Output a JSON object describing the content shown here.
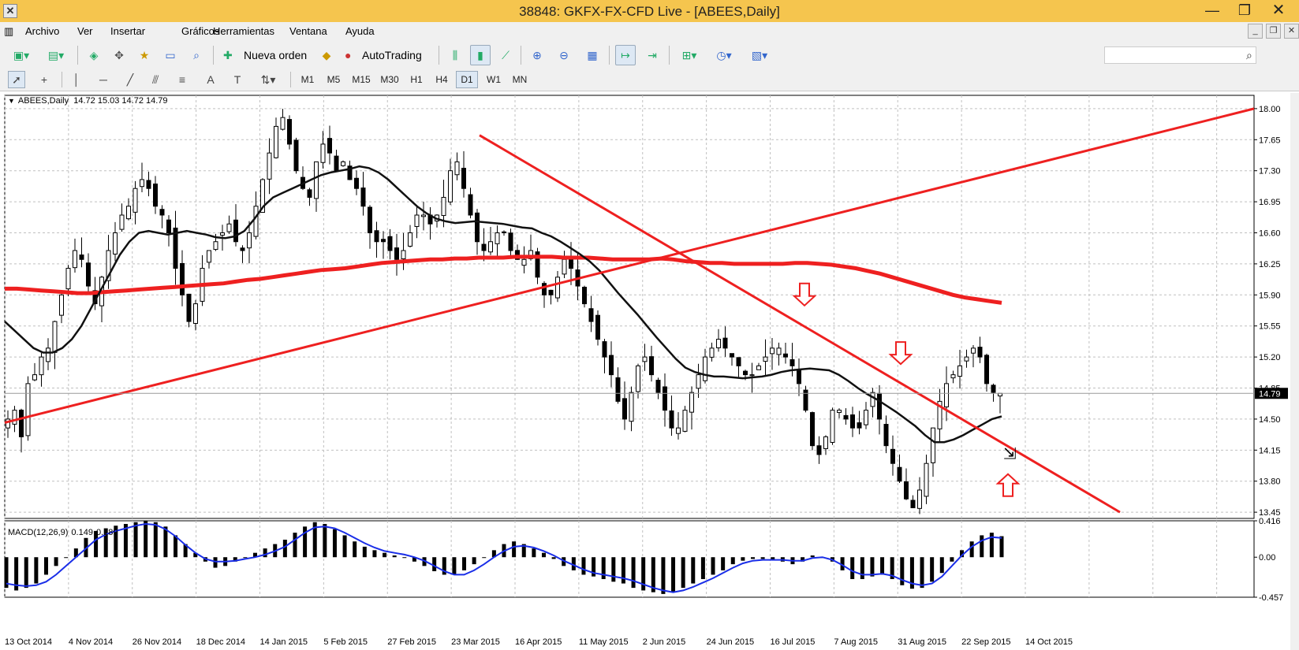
{
  "window": {
    "title": "38848: GKFX-FX-CFD Live - [ABEES,Daily]",
    "minimize": "—",
    "maximize": "❐",
    "close": "✕"
  },
  "menu": {
    "items": [
      "Archivo",
      "Ver",
      "Insertar",
      "Gráficos",
      "Herramientas",
      "Ventana",
      "Ayuda"
    ]
  },
  "toolbar": {
    "new_order": "Nueva orden",
    "autotrading": "AutoTrading",
    "search_placeholder": ""
  },
  "timeframes": [
    "M1",
    "M5",
    "M15",
    "M30",
    "H1",
    "H4",
    "D1",
    "W1",
    "MN"
  ],
  "selected_timeframe": "D1",
  "colors": {
    "trendline": "#ee2020",
    "ma200": "#ee2020",
    "ma50": "#111111",
    "macd_signal": "#1a2ee8",
    "candle": "#000000",
    "grid": "#c0c0c0",
    "titlebar": "#f5c54e"
  },
  "chart_data": {
    "type": "candlestick",
    "symbol_header": {
      "symbol": "ABEES,Daily",
      "ohlc": "14.72 15.03 14.72 14.79"
    },
    "price_axis_ticks": [
      "18.00",
      "17.65",
      "17.30",
      "16.95",
      "16.60",
      "16.25",
      "15.90",
      "15.55",
      "15.20",
      "14.85",
      "14.50",
      "14.15",
      "13.80",
      "13.45"
    ],
    "price_ylim": [
      13.38,
      18.15
    ],
    "current_price": "14.79",
    "date_ticks": [
      "13 Oct 2014",
      "4 Nov 2014",
      "26 Nov 2014",
      "18 Dec 2014",
      "14 Jan 2015",
      "5 Feb 2015",
      "27 Feb 2015",
      "23 Mar 2015",
      "16 Apr 2015",
      "11 May 2015",
      "2 Jun 2015",
      "24 Jun 2015",
      "16 Jul 2015",
      "7 Aug 2015",
      "31 Aug 2015",
      "22 Sep 2015",
      "14 Oct 2015"
    ],
    "closes": [
      14.5,
      14.6,
      14.3,
      14.9,
      15.0,
      15.2,
      15.3,
      15.6,
      15.9,
      16.2,
      16.4,
      16.3,
      16.0,
      15.8,
      16.1,
      16.4,
      16.6,
      16.8,
      16.9,
      17.1,
      17.2,
      17.1,
      16.9,
      16.8,
      16.6,
      16.2,
      15.9,
      15.6,
      15.8,
      16.2,
      16.4,
      16.5,
      16.6,
      16.7,
      16.5,
      16.4,
      16.6,
      16.9,
      17.2,
      17.5,
      17.8,
      17.9,
      17.6,
      17.3,
      17.1,
      17.0,
      17.4,
      17.6,
      17.5,
      17.3,
      17.4,
      17.2,
      17.1,
      16.9,
      16.6,
      16.5,
      16.5,
      16.4,
      16.3,
      16.4,
      16.6,
      16.8,
      16.8,
      16.7,
      16.8,
      17.0,
      17.3,
      17.4,
      17.1,
      16.8,
      16.5,
      16.4,
      16.5,
      16.6,
      16.6,
      16.4,
      16.3,
      16.3,
      16.4,
      16.1,
      15.9,
      15.9,
      16.1,
      16.3,
      16.2,
      16.0,
      15.8,
      15.6,
      15.4,
      15.2,
      15.0,
      14.7,
      14.5,
      14.8,
      15.1,
      15.2,
      15.0,
      14.8,
      14.6,
      14.4,
      14.4,
      14.6,
      14.8,
      15.0,
      15.2,
      15.3,
      15.4,
      15.3,
      15.2,
      15.1,
      15.0,
      15.0,
      15.1,
      15.2,
      15.3,
      15.3,
      15.2,
      15.1,
      14.9,
      14.6,
      14.2,
      14.1,
      14.3,
      14.6,
      14.6,
      14.5,
      14.4,
      14.4,
      14.6,
      14.8,
      14.5,
      14.2,
      14.0,
      13.8,
      13.6,
      13.5,
      13.7,
      14.0,
      14.4,
      14.7,
      14.9,
      15.0,
      15.1,
      15.2,
      15.3,
      15.2,
      14.9,
      14.8,
      14.79
    ],
    "indicators": {
      "ma200_label": "",
      "ma200": [
        15.97,
        15.97,
        15.96,
        15.95,
        15.94,
        15.93,
        15.92,
        15.92,
        15.93,
        15.94,
        15.95,
        15.96,
        15.97,
        15.98,
        15.99,
        16.0,
        16.01,
        16.02,
        16.03,
        16.05,
        16.07,
        16.08,
        16.1,
        16.12,
        16.14,
        16.16,
        16.18,
        16.19,
        16.2,
        16.22,
        16.24,
        16.26,
        16.27,
        16.28,
        16.29,
        16.3,
        16.3,
        16.31,
        16.31,
        16.32,
        16.32,
        16.32,
        16.33,
        16.33,
        16.33,
        16.33,
        16.32,
        16.32,
        16.32,
        16.31,
        16.3,
        16.3,
        16.3,
        16.3,
        16.31,
        16.3,
        16.28,
        16.27,
        16.26,
        16.26,
        16.25,
        16.25,
        16.25,
        16.25,
        16.25,
        16.26,
        16.26,
        16.25,
        16.24,
        16.22,
        16.2,
        16.17,
        16.14,
        16.1,
        16.06,
        16.02,
        15.98,
        15.94,
        15.9,
        15.87,
        15.85,
        15.83,
        15.81
      ],
      "ma50": [
        15.6,
        15.5,
        15.4,
        15.3,
        15.25,
        15.25,
        15.3,
        15.4,
        15.55,
        15.75,
        15.95,
        16.15,
        16.35,
        16.5,
        16.6,
        16.62,
        16.6,
        16.58,
        16.6,
        16.62,
        16.6,
        16.58,
        16.55,
        16.54,
        16.56,
        16.62,
        16.75,
        16.9,
        17.0,
        17.05,
        17.1,
        17.15,
        17.2,
        17.25,
        17.28,
        17.3,
        17.32,
        17.35,
        17.33,
        17.28,
        17.2,
        17.1,
        17.0,
        16.9,
        16.82,
        16.76,
        16.73,
        16.71,
        16.72,
        16.73,
        16.72,
        16.71,
        16.7,
        16.68,
        16.66,
        16.65,
        16.6,
        16.56,
        16.5,
        16.43,
        16.36,
        16.28,
        16.18,
        16.05,
        15.92,
        15.8,
        15.68,
        15.55,
        15.42,
        15.3,
        15.18,
        15.08,
        15.03,
        15.0,
        14.98,
        14.98,
        14.97,
        14.96,
        14.97,
        14.98,
        15.0,
        15.03,
        15.05,
        15.06,
        15.07,
        15.06,
        15.05,
        15.0,
        14.93,
        14.85,
        14.78,
        14.72,
        14.65,
        14.58,
        14.5,
        14.42,
        14.32,
        14.24,
        14.24,
        14.27,
        14.32,
        14.38,
        14.44,
        14.5,
        14.53
      ],
      "trendlines": [
        {
          "from": [
            "13 Oct 2014",
            14.46
          ],
          "to": [
            "off-chart",
            18.0
          ]
        },
        {
          "from": [
            "2 Apr 2015",
            17.7
          ],
          "to": [
            "Nov 2015",
            13.45
          ]
        }
      ],
      "arrows": [
        {
          "date": "10 Aug 2015",
          "direction": "down",
          "price": 15.78
        },
        {
          "date": "3 Sep 2015",
          "direction": "down",
          "price": 15.12
        },
        {
          "date": "18 Oct 2015",
          "direction": "up",
          "price": 13.88
        }
      ]
    },
    "macd": {
      "label": "MACD(12,26,9)",
      "main": "0.149",
      "signal": "0.189",
      "axis_ticks": [
        "0.416",
        "0.00",
        "-0.457"
      ],
      "ylim": [
        -0.457,
        0.416
      ],
      "histogram": [
        -0.35,
        -0.38,
        -0.35,
        -0.3,
        -0.2,
        -0.1,
        0.0,
        0.1,
        0.22,
        0.3,
        0.33,
        0.36,
        0.38,
        0.4,
        0.42,
        0.4,
        0.35,
        0.25,
        0.15,
        0.05,
        -0.05,
        -0.12,
        -0.1,
        -0.05,
        0.0,
        0.05,
        0.1,
        0.15,
        0.2,
        0.28,
        0.35,
        0.4,
        0.38,
        0.32,
        0.25,
        0.18,
        0.12,
        0.08,
        0.05,
        0.02,
        0.0,
        -0.05,
        -0.1,
        -0.16,
        -0.2,
        -0.2,
        -0.15,
        -0.08,
        0.0,
        0.08,
        0.15,
        0.18,
        0.15,
        0.1,
        0.05,
        -0.02,
        -0.1,
        -0.15,
        -0.2,
        -0.22,
        -0.25,
        -0.28,
        -0.3,
        -0.35,
        -0.38,
        -0.4,
        -0.42,
        -0.4,
        -0.35,
        -0.3,
        -0.25,
        -0.2,
        -0.15,
        -0.08,
        -0.04,
        -0.02,
        -0.02,
        -0.03,
        -0.05,
        -0.08,
        -0.05,
        0.02,
        0.0,
        -0.05,
        -0.15,
        -0.25,
        -0.25,
        -0.22,
        -0.2,
        -0.25,
        -0.32,
        -0.36,
        -0.35,
        -0.28,
        -0.18,
        -0.05,
        0.08,
        0.18,
        0.25,
        0.28,
        0.24
      ],
      "signal_line": [
        -0.3,
        -0.32,
        -0.33,
        -0.32,
        -0.28,
        -0.2,
        -0.1,
        0.0,
        0.1,
        0.2,
        0.26,
        0.3,
        0.33,
        0.36,
        0.38,
        0.37,
        0.32,
        0.24,
        0.14,
        0.05,
        -0.02,
        -0.05,
        -0.05,
        -0.04,
        -0.02,
        0.0,
        0.03,
        0.07,
        0.12,
        0.2,
        0.28,
        0.34,
        0.35,
        0.33,
        0.28,
        0.22,
        0.16,
        0.11,
        0.07,
        0.05,
        0.03,
        0.0,
        -0.04,
        -0.1,
        -0.16,
        -0.2,
        -0.2,
        -0.15,
        -0.08,
        0.0,
        0.07,
        0.12,
        0.13,
        0.11,
        0.07,
        0.02,
        -0.04,
        -0.09,
        -0.14,
        -0.18,
        -0.2,
        -0.22,
        -0.24,
        -0.27,
        -0.31,
        -0.35,
        -0.38,
        -0.4,
        -0.38,
        -0.34,
        -0.29,
        -0.24,
        -0.18,
        -0.12,
        -0.07,
        -0.04,
        -0.03,
        -0.03,
        -0.03,
        -0.04,
        -0.04,
        -0.01,
        0.0,
        -0.03,
        -0.09,
        -0.16,
        -0.2,
        -0.2,
        -0.19,
        -0.21,
        -0.26,
        -0.3,
        -0.32,
        -0.3,
        -0.22,
        -0.1,
        0.02,
        0.12,
        0.19,
        0.23,
        0.22
      ]
    }
  }
}
